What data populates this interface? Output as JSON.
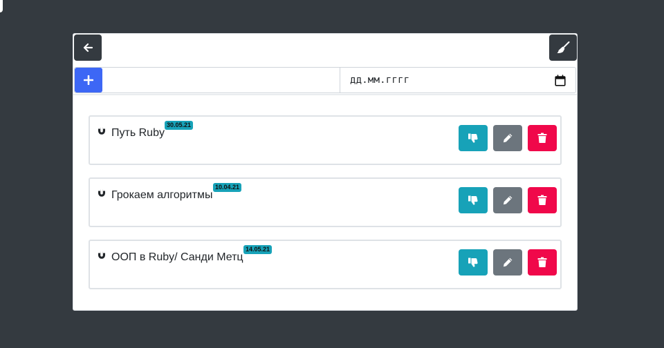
{
  "header": {
    "back_icon": "arrow-left-icon",
    "clear_icon": "broom-icon"
  },
  "form": {
    "add_icon": "plus-icon",
    "title_value": "",
    "date_placeholder": "дд.мм.гггг",
    "calendar_icon": "calendar-icon"
  },
  "books": [
    {
      "title": "Путь Ruby",
      "date": "30.05.21"
    },
    {
      "title": "Грокаем алгоритмы",
      "date": "10.04.21"
    },
    {
      "title": "ООП в Ruby/ Санди Метц",
      "date": "14.05.21"
    }
  ],
  "colors": {
    "background": "#343a40",
    "primary": "#3d67f5",
    "info": "#17a2b8",
    "secondary": "#6c757d",
    "danger": "#f0084a"
  }
}
